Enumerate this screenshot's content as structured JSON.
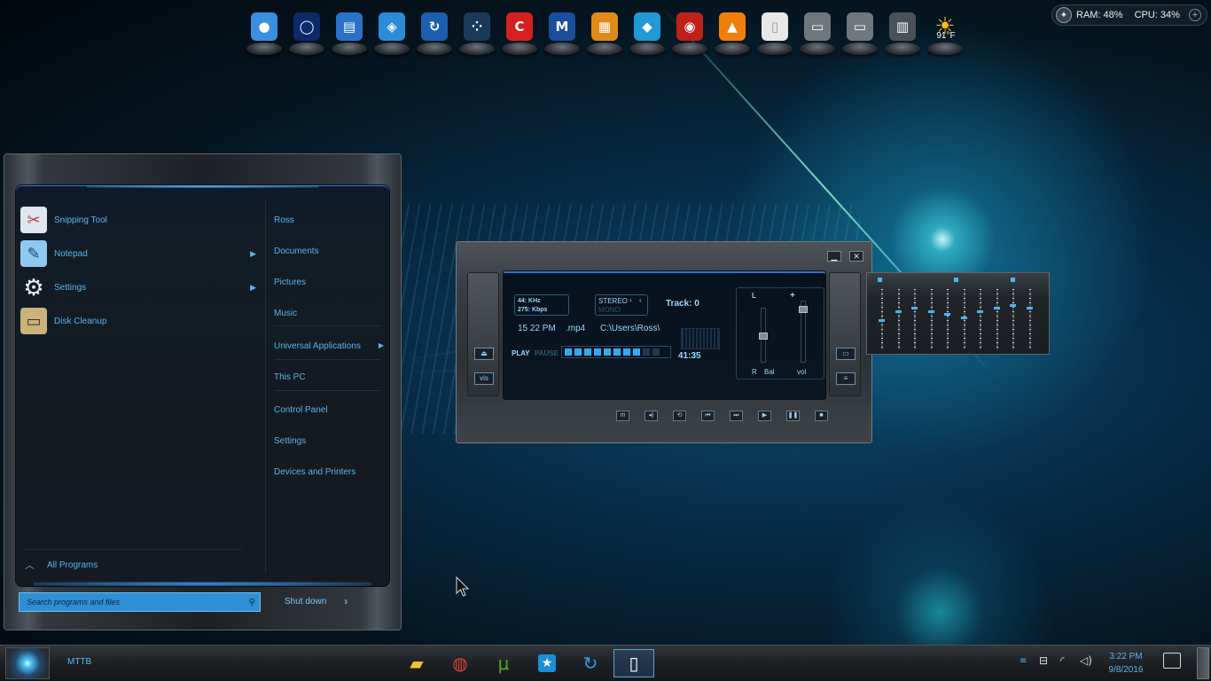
{
  "dock": {
    "items": [
      {
        "name": "dock-app-1",
        "icon": "balls-icon",
        "color": "#3a8fe0"
      },
      {
        "name": "dock-app-2",
        "icon": "ring-icon",
        "color": "#0a2a6a"
      },
      {
        "name": "dock-app-3",
        "icon": "books-icon",
        "color": "#2a72c8"
      },
      {
        "name": "dock-app-4",
        "icon": "layers-icon",
        "color": "#2a8cd8"
      },
      {
        "name": "dock-app-5",
        "icon": "sync-icon",
        "color": "#1c5fb0"
      },
      {
        "name": "dock-app-6",
        "icon": "dots-icon",
        "color": "#1a3a5a"
      },
      {
        "name": "dock-app-ccleaner",
        "icon": "ccleaner-icon",
        "color": "#d62020"
      },
      {
        "name": "dock-app-malwarebytes",
        "icon": "malwarebytes-icon",
        "color": "#1a4d9a"
      },
      {
        "name": "dock-app-avg",
        "icon": "avg-icon",
        "color": "#e08a1a"
      },
      {
        "name": "dock-app-diamond",
        "icon": "diamond-icon",
        "color": "#1f9ad6"
      },
      {
        "name": "dock-app-eye",
        "icon": "eye-icon",
        "color": "#c0201a"
      },
      {
        "name": "dock-app-vlc",
        "icon": "vlc-icon",
        "color": "#f07f0a"
      },
      {
        "name": "dock-app-document",
        "icon": "blank-document-icon",
        "color": "#e8e8e8"
      },
      {
        "name": "dock-app-drive-1",
        "icon": "hard-drive-icon",
        "color": "#6f767c"
      },
      {
        "name": "dock-app-drive-2",
        "icon": "hard-drive-icon",
        "color": "#6f767c"
      },
      {
        "name": "dock-app-trash",
        "icon": "recycle-bin-icon",
        "color": "#4a5157"
      },
      {
        "name": "dock-app-weather",
        "icon": "sun-icon",
        "color": "#f0b020"
      }
    ],
    "weather_temp": "91°F"
  },
  "meter": {
    "ram": "RAM: 48%",
    "cpu": "CPU: 34%"
  },
  "start_menu": {
    "programs": [
      {
        "label": "Snipping Tool",
        "icon": "scissors-icon",
        "has_submenu": false
      },
      {
        "label": "Notepad",
        "icon": "notepad-icon",
        "has_submenu": true
      },
      {
        "label": "Settings",
        "icon": "gear-icon",
        "has_submenu": true
      },
      {
        "label": "Disk Cleanup",
        "icon": "disk-cleanup-icon",
        "has_submenu": false
      }
    ],
    "all_programs": "All Programs",
    "places": [
      {
        "label": "Ross"
      },
      {
        "label": "Documents"
      },
      {
        "label": "Pictures"
      },
      {
        "label": "Music"
      },
      {
        "label": "Universal Applications"
      },
      {
        "label": "This PC"
      },
      {
        "label": "Control Panel"
      },
      {
        "label": "Settings"
      },
      {
        "label": "Devices and Printers"
      }
    ],
    "search_placeholder": "Search programs and files",
    "shutdown": "Shut down"
  },
  "player": {
    "khz": "44: KHz",
    "kbps": "275: Kbps",
    "stereo": "STEREO",
    "mono": "MONO",
    "track": "Track: 0",
    "time_text": "15 22 PM",
    "format": ".mp4",
    "path": "C:\\Users\\Ross\\",
    "play": "PLAY",
    "pause": "PAUSE",
    "elapsed": "41:35",
    "progress_fraction": 0.8,
    "mixer_l": "L",
    "mixer_plus": "+",
    "mixer_r": "R",
    "mixer_bal": "Bal",
    "mixer_vol": "vol",
    "vis_label": "vis"
  },
  "equalizer": {
    "levels": [
      0.5,
      0.35,
      0.3,
      0.35,
      0.4,
      0.45,
      0.35,
      0.3,
      0.25,
      0.3
    ]
  },
  "taskbar": {
    "label": "MTTB",
    "apps": [
      {
        "name": "file-explorer",
        "icon": "folder-icon",
        "color": "#f1c232"
      },
      {
        "name": "chrome",
        "icon": "chrome-icon",
        "color": "#db4437"
      },
      {
        "name": "utorrent",
        "icon": "utorrent-icon",
        "color": "#4caf1a"
      },
      {
        "name": "app-star",
        "icon": "star-badge-icon",
        "color": "#1a8fd6"
      },
      {
        "name": "app-sync",
        "icon": "sync-icon",
        "color": "#3a9be8"
      },
      {
        "name": "blank-document",
        "icon": "blank-document-icon",
        "color": "#ffffff"
      }
    ],
    "time": "3:22 PM",
    "date": "9/8/2016"
  }
}
